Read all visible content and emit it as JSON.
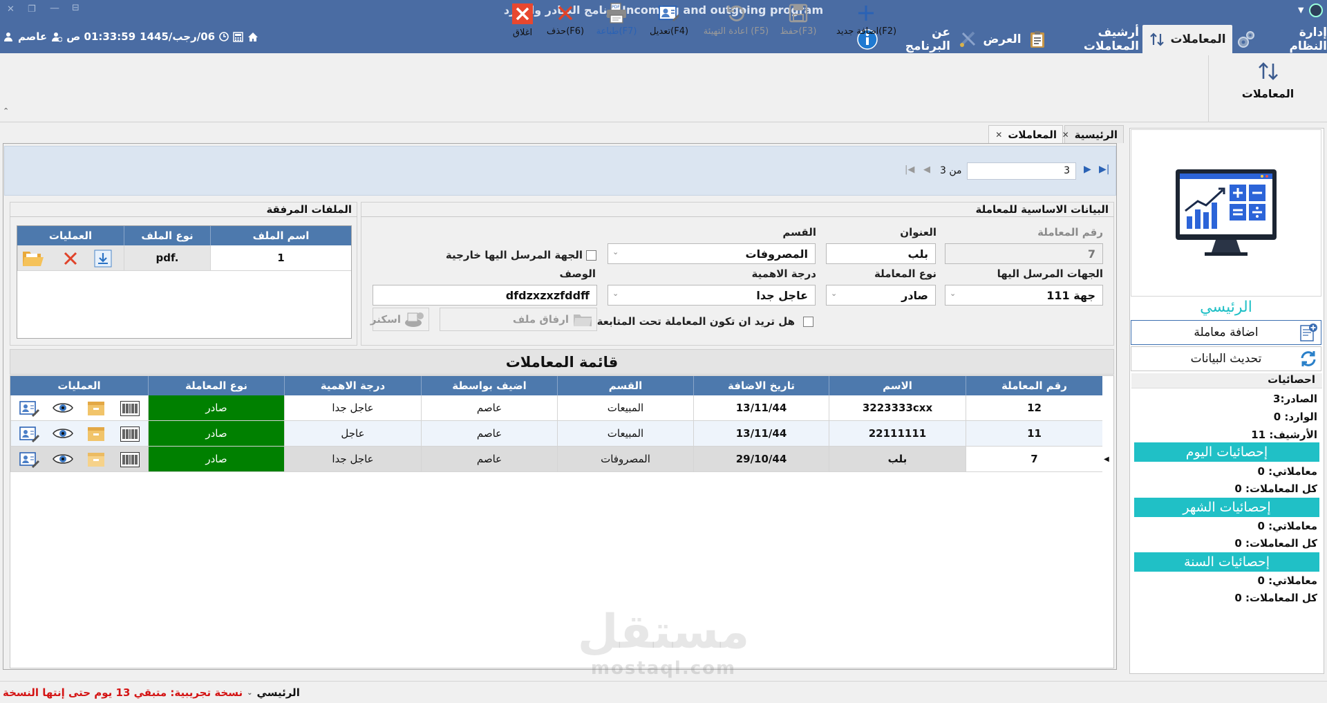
{
  "window": {
    "title": "برنامج الصادر والوارد Incoming and outgoing program"
  },
  "ribbon_tabs": [
    {
      "label": "إدارة النظام"
    },
    {
      "label": "المعاملات"
    },
    {
      "label": "أرشيف المعاملات"
    },
    {
      "label": "العرض"
    },
    {
      "label": "عن البرنامج"
    }
  ],
  "session": {
    "user": "عاصم",
    "time": "01:33:59 ص",
    "date": "06/رجب/1445"
  },
  "ribbon": {
    "button_label": "المعاملات"
  },
  "doc_tabs": [
    {
      "label": "الرئيسية"
    },
    {
      "label": "المعاملات"
    }
  ],
  "toolbar": {
    "page_input": "3",
    "of_label": "من 3",
    "add": "اضافة جديد(F2)",
    "save": "حفظ(F3)",
    "reset": "اعادة التهيئة (F5)",
    "edit": "تعديل(F4)",
    "print": "طباعة(F7)",
    "delete": "حذف(F6)",
    "close": "اغلاق"
  },
  "basic_data": {
    "title": "البيانات الاساسية للمعاملة",
    "labels": {
      "number": "رقم المعاملة",
      "subject": "العنوان",
      "department": "القسم",
      "recipients": "الجهات المرسل اليها",
      "type": "نوع المعاملة",
      "priority": "درجة الاهمية",
      "description": "الوصف",
      "external": "الجهة المرسل اليها خارجية",
      "followup": "هل تريد ان تكون المعاملة تحت المتابعة",
      "attach": "ارفاق ملف",
      "scan": "اسكنر"
    },
    "values": {
      "number": "7",
      "subject": "بلب",
      "department": "المصروفات",
      "recipients": "جهة 111",
      "type": "صادر",
      "priority": "عاجل جدا",
      "description": "dfdzxzxzfddff"
    }
  },
  "attachments": {
    "title": "الملفات المرفقة",
    "headers": [
      "اسم الملف",
      "نوع الملف",
      "العمليات"
    ],
    "rows": [
      {
        "name": "1",
        "type": "pdf."
      }
    ]
  },
  "transactions": {
    "title": "قائمة المعاملات",
    "headers": [
      "رقم المعاملة",
      "الاسم",
      "تاريخ الاضافة",
      "القسم",
      "اضيف بواسطة",
      "درجة الاهمية",
      "نوع المعاملة",
      "العمليات"
    ],
    "rows": [
      {
        "number": "12",
        "name": "3223333cxx",
        "date": "13/11/44",
        "department": "المبيعات",
        "added_by": "عاصم",
        "priority": "عاجل جدا",
        "type": "صادر"
      },
      {
        "number": "11",
        "name": "22111111",
        "date": "13/11/44",
        "department": "المبيعات",
        "added_by": "عاصم",
        "priority": "عاجل",
        "type": "صادر"
      },
      {
        "number": "7",
        "name": "بلب",
        "date": "29/10/44",
        "department": "المصروفات",
        "added_by": "عاصم",
        "priority": "عاجل جدا",
        "type": "صادر"
      }
    ],
    "type_color": "#008000"
  },
  "side_panel": {
    "title": "الرئيسي",
    "add_button": "اضافة معاملة",
    "refresh_button": "تحديث البيانات",
    "stats_title": "احصائيات",
    "outgoing": "الصادر:3",
    "incoming": "الوارد:  0",
    "archive": "الأرشيف:  11",
    "today_title": "إحصائيات اليوم",
    "month_title": "إحصائيات الشهر",
    "year_title": "إحصائيات السنة",
    "my_tx": "معاملاتي:  0",
    "all_tx": "كل المعاملات:  0",
    "accent": "#20c0c6"
  },
  "status": {
    "main": "الرئيسي",
    "trial": "نسخة تجريبية: متبقي 13 يوم حتى إنتها النسخة"
  },
  "watermark": {
    "text1": "مستقل",
    "text2": "mostaql.com"
  }
}
